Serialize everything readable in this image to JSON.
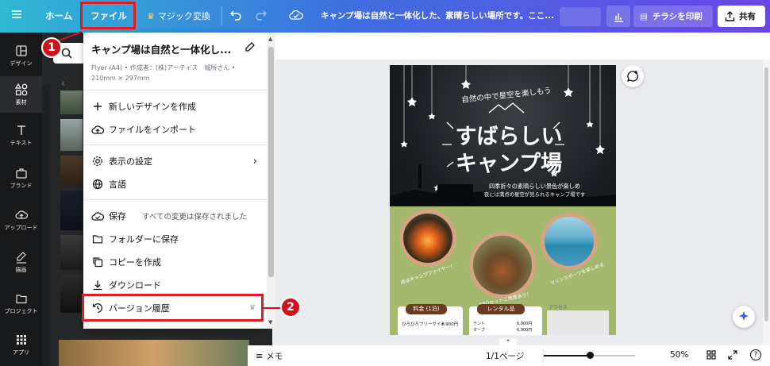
{
  "topbar": {
    "home": "ホーム",
    "file": "ファイル",
    "magic": "マジック変換",
    "doc_title": "キャンプ場は自然と一体化した、素晴らしい場所です。ここ...",
    "print": "チラシを印刷",
    "share": "共有"
  },
  "rail": [
    "デザイン",
    "素材",
    "テキスト",
    "ブランド",
    "アップロード",
    "描画",
    "プロジェクト",
    "アプリ"
  ],
  "menu": {
    "title": "キャンプ場は自然と一体化し...",
    "meta1": "Flyer (A4) • 作成者：(株)アーティス　城所さん •",
    "meta2": "210mm × 297mm",
    "new_design": "新しいデザインを作成",
    "import": "ファイルをインポート",
    "view": "表示の設定",
    "language": "言語",
    "save": "保存",
    "save_status": "すべての変更は保存されました",
    "save_folder": "フォルダーに保存",
    "copy": "コピーを作成",
    "download": "ダウンロード",
    "version": "バージョン履歴"
  },
  "badges": {
    "one": "1",
    "two": "2"
  },
  "flyer": {
    "subtitle": "自然の中で星空を楽しもう",
    "title1": "すばらしい",
    "title2": "キャンプ場",
    "desc1": "四季折々の素晴らしい景色が楽しめ",
    "desc2": "夜には満点の星空が見られるキャンプ場です",
    "circle1": "夜はキャンプファイヤー！",
    "circle2": "BBQセットご用意あり！",
    "circle3": "マリンスポーツを楽しめる",
    "price": "料金 (1泊)",
    "rental": "レンタル品",
    "access": "アクセス",
    "price_row1_label": "ひろびろフリーサイト",
    "price_row1_value": "6,900円",
    "rental_row1_label": "テント",
    "rental_row1_value": "6,900円",
    "rental_row2_label": "タープ",
    "rental_row2_value": "6,900円"
  },
  "bottombar": {
    "memo": "メモ",
    "page": "1/1ページ",
    "zoom": "50%",
    "zoom_level": 0.5
  },
  "colors": {
    "highlight": "#e11b22",
    "flyer_bottom": "#a4b86e",
    "label_brown": "#6b3a1f"
  }
}
